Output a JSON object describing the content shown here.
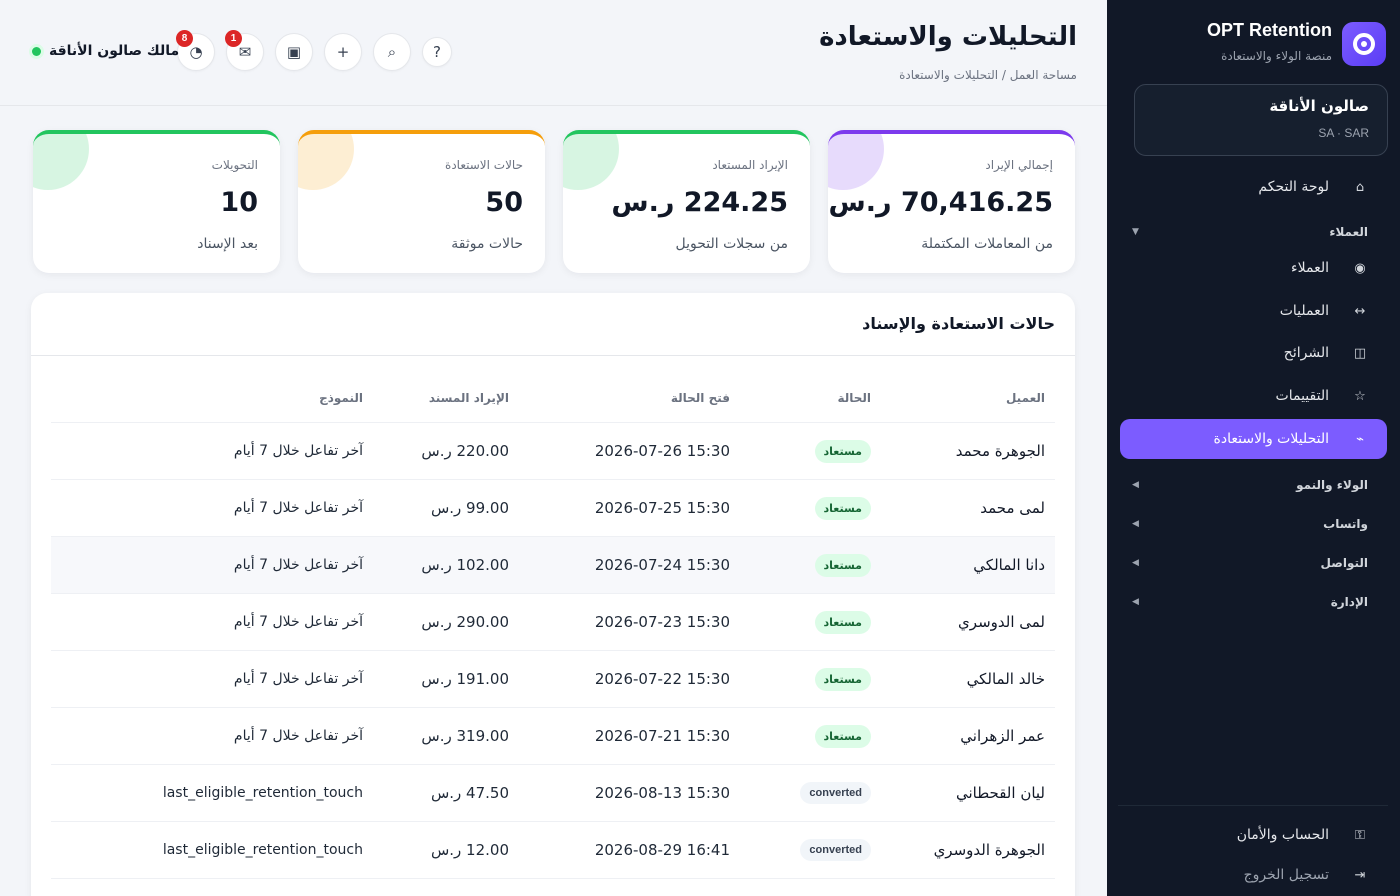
{
  "brand": {
    "name": "OPT Retention",
    "subtitle": "منصة الولاء والاستعادة"
  },
  "tenant": {
    "name": "صالون الأناقة",
    "meta": "SA · SAR"
  },
  "sidebar": {
    "dashboard": {
      "label": "لوحة التحكم",
      "icon": "home-icon"
    },
    "group_customers": "العملاء",
    "customers": {
      "label": "العملاء",
      "icon": "eye-icon"
    },
    "operations": {
      "label": "العمليات",
      "icon": "arrows-icon"
    },
    "segments": {
      "label": "الشرائح",
      "icon": "columns-icon"
    },
    "reviews": {
      "label": "التقييمات",
      "icon": "star-icon"
    },
    "analytics": {
      "label": "التحليلات والاستعادة",
      "icon": "trend-icon"
    },
    "group_loyalty": "الولاء والنمو",
    "group_whatsapp": "واتساب",
    "group_comms": "التواصل",
    "group_admin": "الإدارة",
    "account": {
      "label": "الحساب والأمان",
      "icon": "key-icon"
    },
    "logout": {
      "label": "تسجيل الخروج",
      "icon": "logout-icon"
    }
  },
  "header": {
    "title": "التحليلات والاستعادة",
    "breadcrumb": "مساحة العمل / التحليلات والاستعادة",
    "owner": "مالك صالون الأناقة",
    "notifications_badge": "8",
    "messages_badge": "1"
  },
  "stats": [
    {
      "label": "إجمالي الإيراد",
      "value": "70,416.25 ر.س",
      "sub": "من المعاملات المكتملة",
      "color": "#7c3aed"
    },
    {
      "label": "الإيراد المستعاد",
      "value": "224.25 ر.س",
      "sub": "من سجلات التحويل",
      "color": "#22c55e"
    },
    {
      "label": "حالات الاستعادة",
      "value": "50",
      "sub": "حالات موثقة",
      "color": "#f59e0b"
    },
    {
      "label": "التحويلات",
      "value": "10",
      "sub": "بعد الإسناد",
      "color": "#22c55e"
    }
  ],
  "table": {
    "title": "حالات الاستعادة والإسناد",
    "headers": {
      "customer": "العميل",
      "status": "الحالة",
      "opened": "فتح الحالة",
      "revenue": "الإيراد المسند",
      "model": "النموذج"
    },
    "rows": [
      {
        "customer": "الجوهرة محمد",
        "status": "مستعاد",
        "opened": "2026-07-26 15:30",
        "revenue": "220.00 ر.س",
        "model": "آخر تفاعل خلال 7 أيام"
      },
      {
        "customer": "لمى محمد",
        "status": "مستعاد",
        "opened": "2026-07-25 15:30",
        "revenue": "99.00 ر.س",
        "model": "آخر تفاعل خلال 7 أيام"
      },
      {
        "customer": "دانا المالكي",
        "status": "مستعاد",
        "opened": "2026-07-24 15:30",
        "revenue": "102.00 ر.س",
        "model": "آخر تفاعل خلال 7 أيام"
      },
      {
        "customer": "لمى الدوسري",
        "status": "مستعاد",
        "opened": "2026-07-23 15:30",
        "revenue": "290.00 ر.س",
        "model": "آخر تفاعل خلال 7 أيام"
      },
      {
        "customer": "خالد المالكي",
        "status": "مستعاد",
        "opened": "2026-07-22 15:30",
        "revenue": "191.00 ر.س",
        "model": "آخر تفاعل خلال 7 أيام"
      },
      {
        "customer": "عمر الزهراني",
        "status": "مستعاد",
        "opened": "2026-07-21 15:30",
        "revenue": "319.00 ر.س",
        "model": "آخر تفاعل خلال 7 أيام"
      },
      {
        "customer": "ليان القحطاني",
        "status": "converted",
        "opened": "2026-08-13 15:30",
        "revenue": "47.50 ر.س",
        "model": "last_eligible_retention_touch"
      },
      {
        "customer": "الجوهرة الدوسري",
        "status": "converted",
        "opened": "2026-08-29 16:41",
        "revenue": "12.00 ر.س",
        "model": "last_eligible_retention_touch"
      }
    ]
  }
}
